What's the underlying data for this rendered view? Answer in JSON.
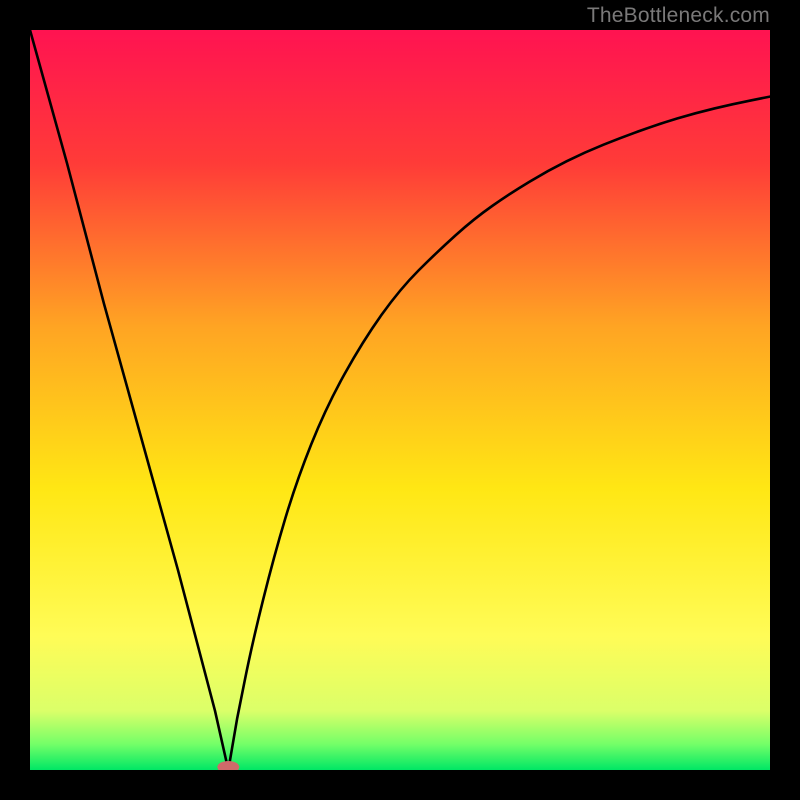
{
  "attribution": "TheBottleneck.com",
  "chart_data": {
    "type": "line",
    "title": "",
    "xlabel": "",
    "ylabel": "",
    "xlim": [
      0,
      100
    ],
    "ylim": [
      0,
      100
    ],
    "series": [
      {
        "name": "bottleneck-curve",
        "x": [
          0,
          5,
          10,
          15,
          20,
          25,
          26.8,
          28,
          30,
          33,
          36,
          40,
          45,
          50,
          55,
          60,
          65,
          70,
          75,
          80,
          85,
          90,
          95,
          100
        ],
        "values": [
          100,
          82,
          63,
          45,
          27,
          8,
          0,
          7,
          17,
          29,
          39,
          49,
          58,
          65,
          70,
          74.5,
          78,
          81,
          83.5,
          85.5,
          87.3,
          88.8,
          90,
          91
        ]
      }
    ],
    "marker": {
      "x": 26.8,
      "y": 0.4
    },
    "gradient_stops": [
      {
        "offset": 0.0,
        "color": "#ff1351"
      },
      {
        "offset": 0.18,
        "color": "#ff3b38"
      },
      {
        "offset": 0.4,
        "color": "#ffa423"
      },
      {
        "offset": 0.62,
        "color": "#ffe714"
      },
      {
        "offset": 0.82,
        "color": "#fffc57"
      },
      {
        "offset": 0.92,
        "color": "#dbff69"
      },
      {
        "offset": 0.965,
        "color": "#74ff68"
      },
      {
        "offset": 1.0,
        "color": "#00e765"
      }
    ]
  }
}
